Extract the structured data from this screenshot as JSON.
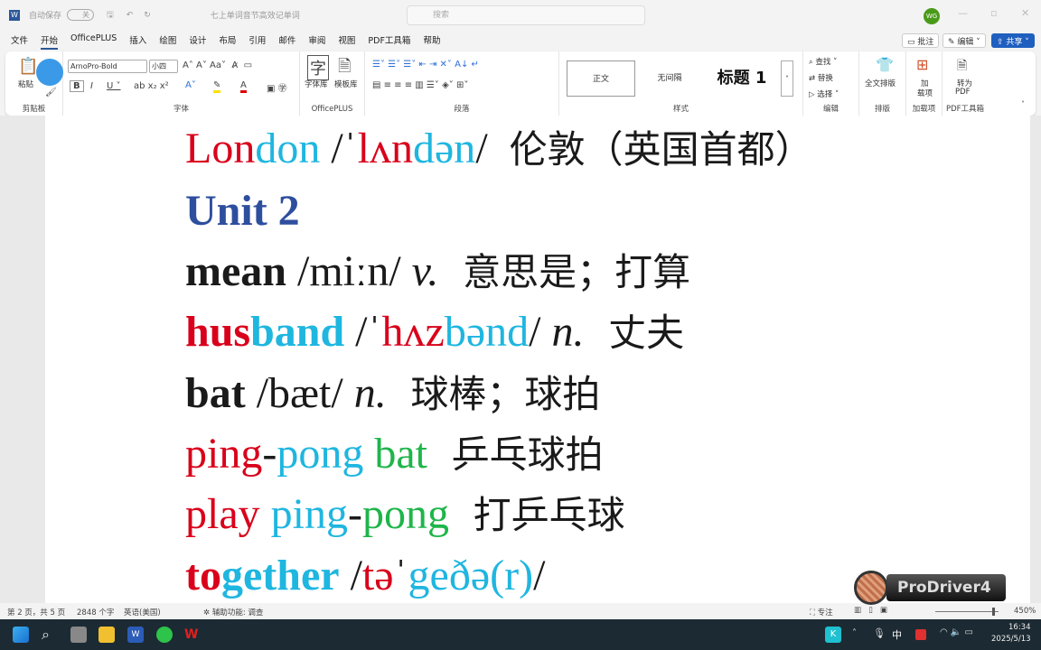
{
  "titlebar": {
    "autosave": "自动保存",
    "autosave_state": "关",
    "doc_title": "七上单词音节高效记单词",
    "search_placeholder": "搜索",
    "user_initials": "WG"
  },
  "menu": [
    "文件",
    "开始",
    "OfficePLUS",
    "插入",
    "绘图",
    "设计",
    "布局",
    "引用",
    "邮件",
    "审阅",
    "视图",
    "PDF工具箱",
    "帮助"
  ],
  "actions": {
    "comment": "批注",
    "edit": "编辑",
    "share": "共享"
  },
  "ribbon": {
    "clipboard": {
      "paste": "粘贴",
      "label": "剪贴板"
    },
    "font": {
      "name": "ArnoPro-Bold",
      "size": "小四",
      "label": "字体"
    },
    "officeplus": {
      "fontlib": "字体库",
      "templates": "模板库",
      "label": "OfficePLUS"
    },
    "paragraph": {
      "label": "段落"
    },
    "styles": {
      "items": [
        "正文",
        "无间隔",
        "标题 1"
      ],
      "label": "样式"
    },
    "editing": {
      "find": "查找",
      "replace": "替换",
      "select": "选择",
      "label": "编辑"
    },
    "layout": {
      "btn": "全文排版",
      "label": "排版"
    },
    "addins": {
      "btn1": "加",
      "btn2": "载项",
      "label": "加载项"
    },
    "pdf": {
      "btn1": "转为",
      "btn2": "PDF",
      "label": "PDF工具箱"
    }
  },
  "colors": {
    "red": "#d9001b",
    "cyan": "#1fb6e0",
    "green": "#1fb54a",
    "blue": "#2e4e9e",
    "black": "#1a1a1a"
  },
  "document": {
    "lines": [
      [
        {
          "t": "Lon",
          "c": "red"
        },
        {
          "t": "don",
          "c": "cyan"
        },
        {
          "t": " /ˈ",
          "c": "black"
        },
        {
          "t": "lʌn",
          "c": "red"
        },
        {
          "t": "dən",
          "c": "cyan"
        },
        {
          "t": "/  ",
          "c": "black"
        },
        {
          "t": "伦敦（英国首都）",
          "c": "black",
          "zh": true
        }
      ],
      [
        {
          "t": "Unit 2",
          "c": "blue",
          "b": true
        }
      ],
      [
        {
          "t": "mean",
          "c": "black",
          "b": true
        },
        {
          "t": " /miːn/ ",
          "c": "black"
        },
        {
          "t": "v.",
          "c": "black",
          "i": true
        },
        {
          "t": "  意思是；打算",
          "c": "black",
          "zh": true
        }
      ],
      [
        {
          "t": "hus",
          "c": "red",
          "b": true
        },
        {
          "t": "band",
          "c": "cyan",
          "b": true
        },
        {
          "t": " /ˈ",
          "c": "black"
        },
        {
          "t": "hʌz",
          "c": "red"
        },
        {
          "t": "bənd",
          "c": "cyan"
        },
        {
          "t": "/ ",
          "c": "black"
        },
        {
          "t": "n.",
          "c": "black",
          "i": true
        },
        {
          "t": "  丈夫",
          "c": "black",
          "zh": true
        }
      ],
      [
        {
          "t": "bat",
          "c": "black",
          "b": true
        },
        {
          "t": " /bæt/ ",
          "c": "black"
        },
        {
          "t": "n.",
          "c": "black",
          "i": true
        },
        {
          "t": "  球棒；球拍",
          "c": "black",
          "zh": true
        }
      ],
      [
        {
          "t": "ping",
          "c": "red"
        },
        {
          "t": "-",
          "c": "black"
        },
        {
          "t": "pong",
          "c": "cyan"
        },
        {
          "t": " bat",
          "c": "green"
        },
        {
          "t": "  乒乓球拍",
          "c": "black",
          "zh": true
        }
      ],
      [
        {
          "t": "play ",
          "c": "red"
        },
        {
          "t": "ping",
          "c": "cyan"
        },
        {
          "t": "-",
          "c": "black"
        },
        {
          "t": "pong",
          "c": "green"
        },
        {
          "t": "  打乒乓球",
          "c": "black",
          "zh": true
        }
      ],
      [
        {
          "t": "to",
          "c": "red",
          "b": true
        },
        {
          "t": "gether",
          "c": "cyan",
          "b": true
        },
        {
          "t": " /",
          "c": "black"
        },
        {
          "t": "tə",
          "c": "red"
        },
        {
          "t": "ˈ",
          "c": "black"
        },
        {
          "t": "geðə(r)",
          "c": "cyan"
        },
        {
          "t": "/",
          "c": "black"
        }
      ]
    ]
  },
  "statusbar": {
    "page": "第 2 页，共 5 页",
    "words": "2848 个字",
    "lang": "英语(美国)",
    "accessibility": "辅助功能: 调查",
    "focus": "专注",
    "zoom": "450%",
    "zoom_level_percent": 450
  },
  "overlay": {
    "logo_text": "ProDriver4"
  },
  "taskbar": {
    "ime": "中",
    "time": "16:34",
    "date": "2025/5/13"
  }
}
